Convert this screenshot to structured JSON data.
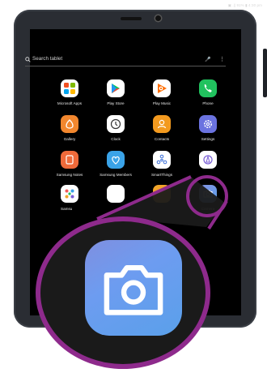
{
  "status_bar": {
    "text": "▣ .∥ 91% ▮ 4:30 pm"
  },
  "search": {
    "placeholder": "Search tablet"
  },
  "apps": [
    {
      "label": "Microsoft Apps",
      "icon": "microsoft-apps-icon",
      "color": "#ffffff"
    },
    {
      "label": "Play Store",
      "icon": "play-store-icon",
      "color": "#ffffff"
    },
    {
      "label": "Play Music",
      "icon": "play-music-icon",
      "color": "#ffffff"
    },
    {
      "label": "Phone",
      "icon": "phone-icon",
      "color": "#21c25e"
    },
    {
      "label": "Gallery",
      "icon": "gallery-icon",
      "color": "#f2872e"
    },
    {
      "label": "Clock",
      "icon": "clock-icon",
      "color": "#ffffff"
    },
    {
      "label": "Contacts",
      "icon": "contacts-icon",
      "color": "#f39a1f"
    },
    {
      "label": "Settings",
      "icon": "settings-icon",
      "color": "#6b73e0"
    },
    {
      "label": "Samsung Notes",
      "icon": "samsung-notes-icon",
      "color": "#ef6a3a"
    },
    {
      "label": "Samsung Members",
      "icon": "samsung-members-icon",
      "color": "#3aa3e8"
    },
    {
      "label": "SmartThings",
      "icon": "smartthings-icon",
      "color": "#ffffff"
    },
    {
      "label": "",
      "icon": "internet-icon",
      "color": "#ffffff"
    },
    {
      "label": "Samsu",
      "icon": "samsung-folder-icon",
      "color": "#ffffff"
    },
    {
      "label": "",
      "icon": "partial-app-icon",
      "color": "#ffffff"
    },
    {
      "label": "",
      "icon": "partial-yellow-app-icon",
      "color": "#f2a52a"
    },
    {
      "label": "Camera",
      "icon": "camera-icon",
      "color": "#6a88e6"
    }
  ],
  "callout": {
    "icon": "camera-icon",
    "ring_color": "#8e2a8c"
  }
}
